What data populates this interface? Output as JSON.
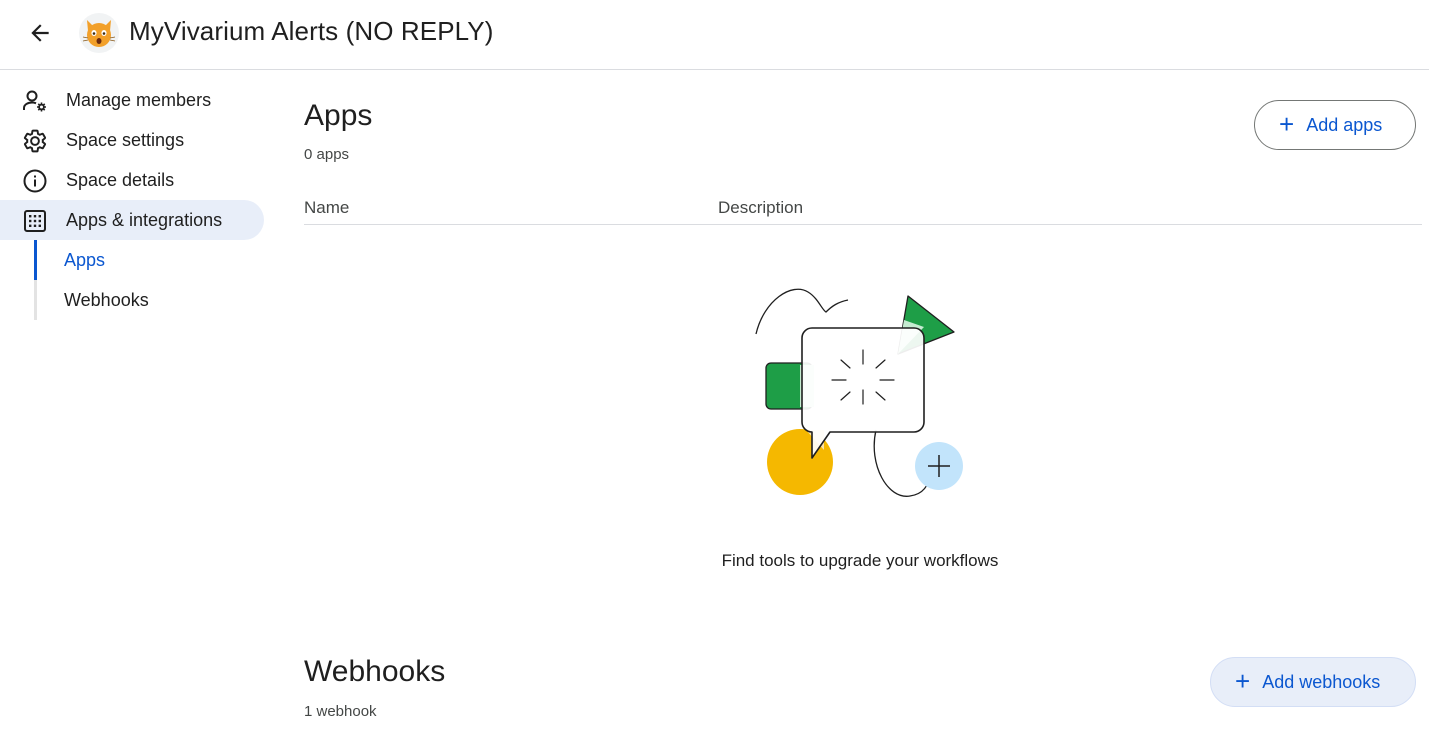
{
  "header": {
    "title": "MyVivarium Alerts (NO REPLY)",
    "back_icon": "arrow-left-icon",
    "avatar_icon": "cat-face-icon"
  },
  "sidebar": {
    "items": [
      {
        "label": "Manage members",
        "icon": "manage-members-icon"
      },
      {
        "label": "Space settings",
        "icon": "gear-icon"
      },
      {
        "label": "Space details",
        "icon": "info-icon"
      },
      {
        "label": "Apps & integrations",
        "icon": "apps-grid-icon",
        "active": true
      }
    ],
    "subitems": [
      {
        "label": "Apps",
        "active": true
      },
      {
        "label": "Webhooks"
      }
    ]
  },
  "apps_section": {
    "title": "Apps",
    "count": "0 apps",
    "add_button": "Add apps",
    "columns": [
      "Name",
      "Description"
    ],
    "empty_message": "Find tools to upgrade your workflows"
  },
  "webhooks_section": {
    "title": "Webhooks",
    "count": "1 webhook",
    "add_button": "Add webhooks"
  },
  "colors": {
    "accent": "#0b57d0",
    "active_bg": "#e8eef9",
    "divider": "#dadce0",
    "illus_green": "#1e9e47",
    "illus_light_green": "#c5ecd1",
    "illus_yellow": "#f5b800",
    "illus_light_blue": "#c2e4fb"
  }
}
